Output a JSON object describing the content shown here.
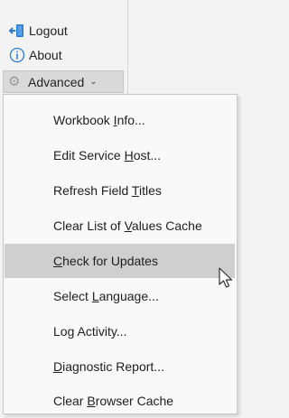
{
  "ribbon": {
    "logout": {
      "label": "Logout",
      "icon": "logout-icon"
    },
    "about": {
      "label": "About",
      "icon": "info-icon"
    },
    "advanced": {
      "label": "Advanced",
      "icon": "gear-icon",
      "chevron": "chevron-down-icon"
    }
  },
  "menu": {
    "items": [
      {
        "pre": "Workbook ",
        "key": "I",
        "post": "nfo...",
        "full": "Workbook Info..."
      },
      {
        "pre": "Edit Service ",
        "key": "H",
        "post": "ost...",
        "full": "Edit Service Host..."
      },
      {
        "pre": "Refresh Field ",
        "key": "T",
        "post": "itles",
        "full": "Refresh Field Titles"
      },
      {
        "pre": "Clear List of ",
        "key": "V",
        "post": "alues Cache",
        "full": "Clear List of Values Cache"
      },
      {
        "pre": "",
        "key": "C",
        "post": "heck for Updates",
        "full": "Check for Updates",
        "hovered": true
      },
      {
        "pre": "Select ",
        "key": "L",
        "post": "anguage...",
        "full": "Select Language..."
      },
      {
        "pre": "Lo",
        "key": "g",
        "post": " Activity...",
        "full": "Log Activity..."
      },
      {
        "pre": "",
        "key": "D",
        "post": "iagnostic Report...",
        "full": "Diagnostic Report..."
      },
      {
        "pre": "Clear ",
        "key": "B",
        "post": "rowser Cache",
        "full": "Clear Browser Cache"
      }
    ]
  },
  "colors": {
    "accent": "#2b7cd3",
    "hover": "#cfcfcf"
  }
}
